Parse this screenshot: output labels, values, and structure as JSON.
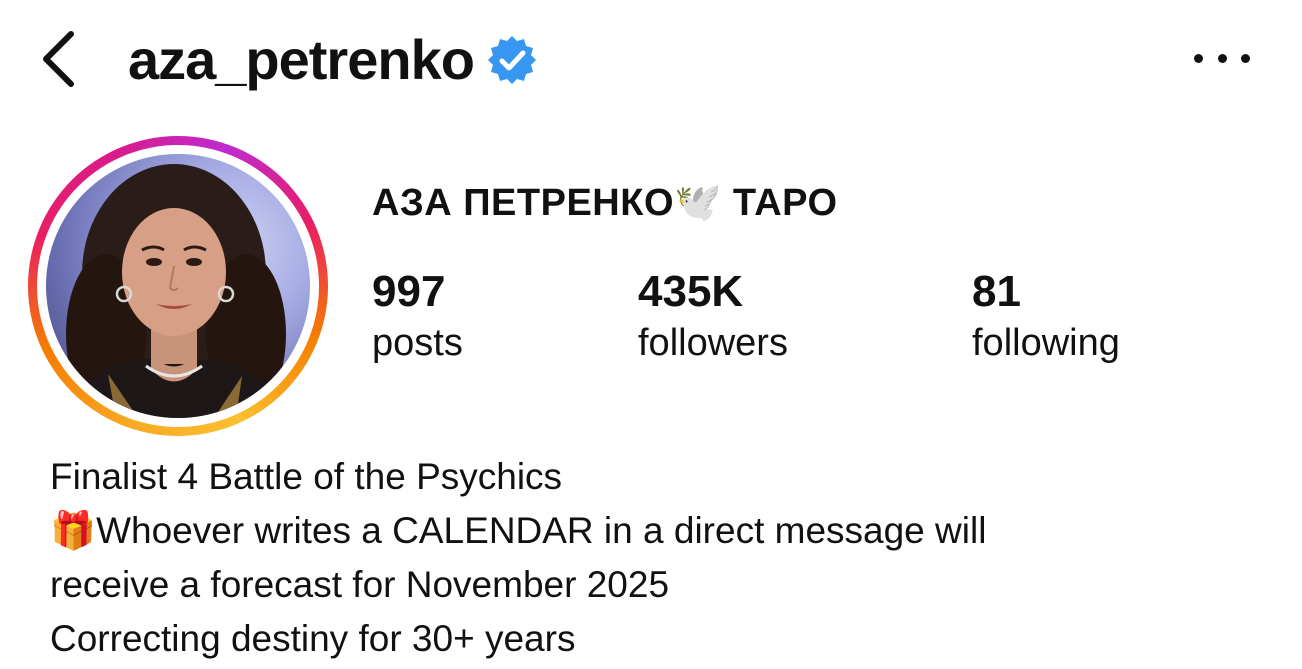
{
  "header": {
    "username": "aza_petrenko",
    "verified": true
  },
  "profile": {
    "display_name": "АЗА ПЕТРЕНКО🕊️ ТАРО",
    "stats": {
      "posts_count": "997",
      "posts_label": "posts",
      "followers_count": "435K",
      "followers_label": "followers",
      "following_count": "81",
      "following_label": "following"
    },
    "bio": [
      "Finalist 4 Battle of the Psychics",
      "🎁Whoever writes a CALENDAR in a direct message will",
      "receive a forecast for November 2025",
      "Correcting destiny for 30+ years"
    ]
  },
  "colors": {
    "verified_blue": "#3897f0",
    "text": "#111111",
    "story_ring": [
      "#f9a825",
      "#e91e63",
      "#c02bd0"
    ]
  },
  "icons": {
    "back": "chevron-left-icon",
    "verified": "verified-badge-icon",
    "more": "more-horizontal-icon"
  }
}
